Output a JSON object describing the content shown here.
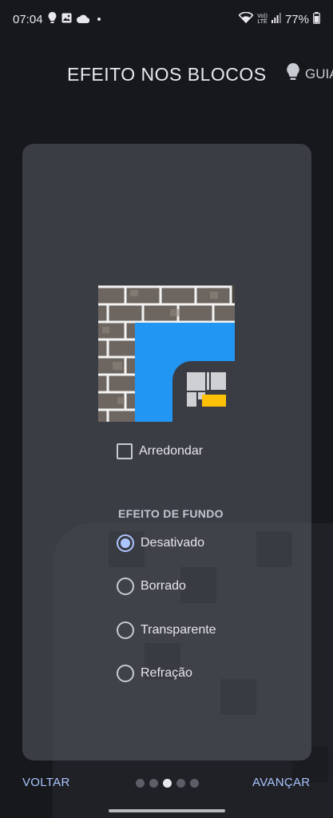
{
  "status_bar": {
    "time": "07:04",
    "carrier_top": "Vo))",
    "carrier_bottom": "LTE",
    "battery": "77%",
    "icons": [
      "lightbulb-icon",
      "image-icon",
      "cloud-icon",
      "dot-icon",
      "wifi-icon",
      "signal-icon",
      "battery-icon"
    ]
  },
  "header": {
    "title": "EFEITO NOS BLOCOS",
    "guide_label": "GUIA",
    "guide_icon": "lightbulb-icon"
  },
  "settings": {
    "round_checkbox_label": "Arredondar",
    "round_checked": false,
    "background_effect_title": "EFEITO DE FUNDO",
    "options": [
      {
        "label": "Desativado",
        "selected": true
      },
      {
        "label": "Borrado",
        "selected": false
      },
      {
        "label": "Transparente",
        "selected": false
      },
      {
        "label": "Refração",
        "selected": false
      }
    ]
  },
  "footer": {
    "back_label": "VOLTAR",
    "next_label": "AVANÇAR",
    "page_count": 5,
    "current_page": 3
  },
  "colors": {
    "accent": "#aec6ff",
    "tile_blue": "#2196f3",
    "badge_yellow": "#ffc107",
    "card_bg": "#3b3d45",
    "page_bg": "#17181c"
  }
}
